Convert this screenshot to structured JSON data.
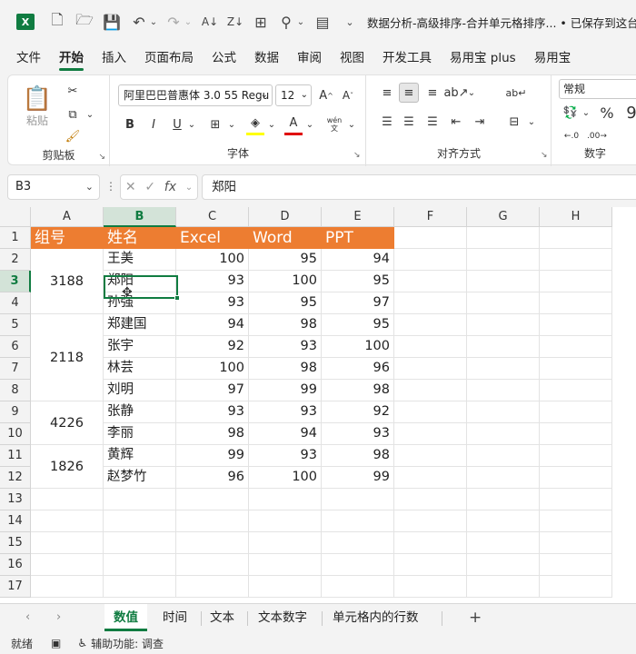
{
  "title": "数据分析-高级排序-合并单元格排序... • 已保存到这台电",
  "quick_access": {
    "app_icon": "X"
  },
  "menu": [
    "文件",
    "开始",
    "插入",
    "页面布局",
    "公式",
    "数据",
    "审阅",
    "视图",
    "开发工具",
    "易用宝 plus",
    "易用宝"
  ],
  "ribbon": {
    "clipboard": {
      "label": "剪贴板",
      "paste": "粘贴"
    },
    "font": {
      "label": "字体",
      "font_name": "阿里巴巴普惠体 3.0 55 Regu",
      "font_size": "12",
      "bold": "B",
      "italic": "I",
      "underline": "U",
      "wen": "wén"
    },
    "align": {
      "label": "对齐方式"
    },
    "number": {
      "label": "数字",
      "format": "常规",
      "percent": "%"
    }
  },
  "formula_bar": {
    "name_box": "B3",
    "fx": "fx",
    "content": "郑阳"
  },
  "columns": [
    "A",
    "B",
    "C",
    "D",
    "E",
    "F",
    "G",
    "H"
  ],
  "rows": [
    "1",
    "2",
    "3",
    "4",
    "5",
    "6",
    "7",
    "8",
    "9",
    "10",
    "11",
    "12",
    "13",
    "14",
    "15",
    "16",
    "17"
  ],
  "header_row": [
    "组号",
    "姓名",
    "Excel",
    "Word",
    "PPT"
  ],
  "groups": [
    {
      "id": "3188",
      "rows": 3
    },
    {
      "id": "2118",
      "rows": 4
    },
    {
      "id": "4226",
      "rows": 2
    },
    {
      "id": "1826",
      "rows": 2
    }
  ],
  "data_rows": [
    {
      "name": "王美",
      "excel": "100",
      "word": "95",
      "ppt": "94"
    },
    {
      "name": "郑阳",
      "excel": "93",
      "word": "100",
      "ppt": "95"
    },
    {
      "name": "孙强",
      "excel": "93",
      "word": "95",
      "ppt": "97"
    },
    {
      "name": "郑建国",
      "excel": "94",
      "word": "98",
      "ppt": "95"
    },
    {
      "name": "张宇",
      "excel": "92",
      "word": "93",
      "ppt": "100"
    },
    {
      "name": "林芸",
      "excel": "100",
      "word": "98",
      "ppt": "96"
    },
    {
      "name": "刘明",
      "excel": "97",
      "word": "99",
      "ppt": "98"
    },
    {
      "name": "张静",
      "excel": "93",
      "word": "93",
      "ppt": "92"
    },
    {
      "name": "李丽",
      "excel": "98",
      "word": "94",
      "ppt": "93"
    },
    {
      "name": "黄辉",
      "excel": "99",
      "word": "93",
      "ppt": "98"
    },
    {
      "name": "赵梦竹",
      "excel": "96",
      "word": "100",
      "ppt": "99"
    }
  ],
  "sheets": [
    "数值",
    "时间",
    "文本",
    "文本数字",
    "单元格内的行数"
  ],
  "active_sheet": 0,
  "status": {
    "ready": "就绪",
    "accessibility": "辅助功能: 调查"
  },
  "colors": {
    "accent": "#107c41",
    "header_fill": "#ed7d31"
  }
}
